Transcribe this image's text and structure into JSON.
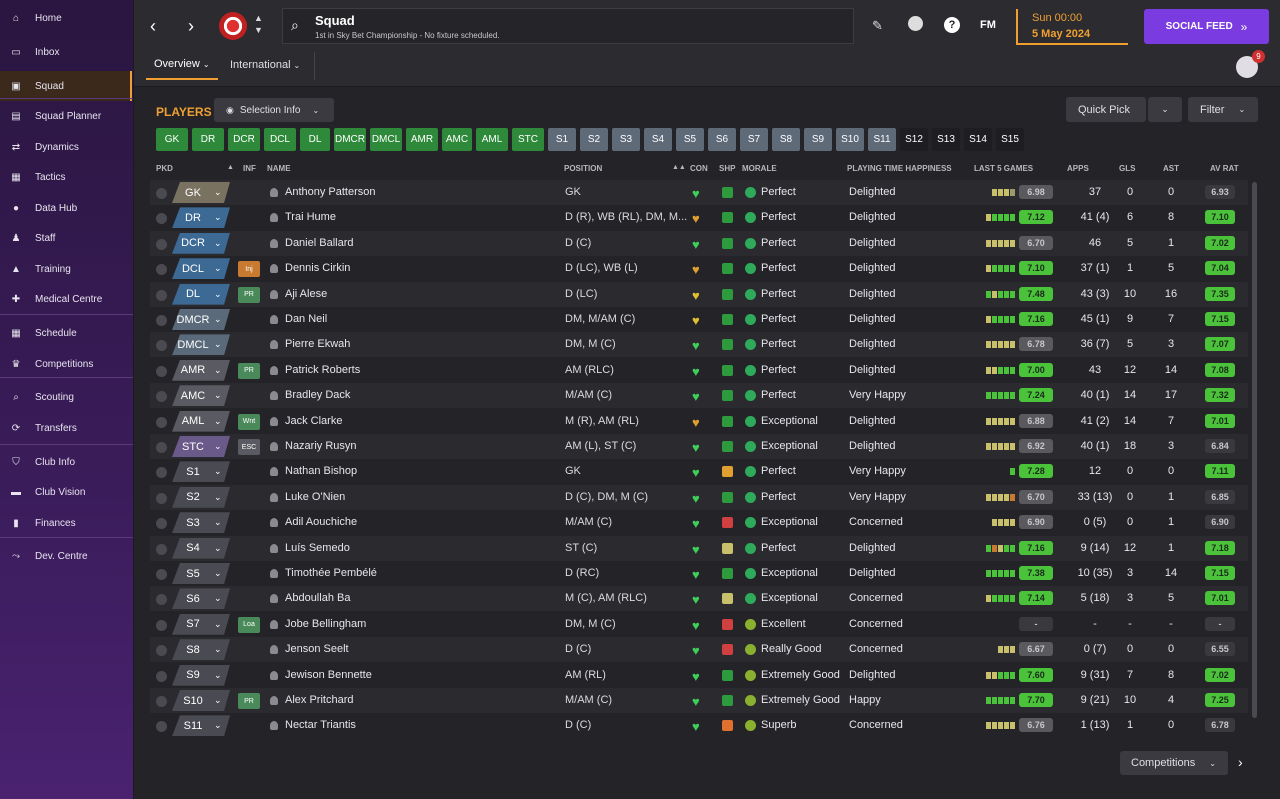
{
  "nav": [
    {
      "label": "Home",
      "icon": "home-icon"
    },
    {
      "label": "Inbox",
      "icon": "inbox-icon"
    },
    {
      "label": "Squad",
      "icon": "shirt-icon",
      "active": true
    },
    {
      "label": "Squad Planner",
      "icon": "clipboard-icon"
    },
    {
      "label": "Dynamics",
      "icon": "dynamics-icon"
    },
    {
      "label": "Tactics",
      "icon": "tactics-icon"
    },
    {
      "label": "Data Hub",
      "icon": "data-hub-icon"
    },
    {
      "label": "Staff",
      "icon": "staff-icon"
    },
    {
      "label": "Training",
      "icon": "training-icon"
    },
    {
      "label": "Medical Centre",
      "icon": "medical-icon"
    },
    {
      "label": "Schedule",
      "icon": "calendar-icon"
    },
    {
      "label": "Competitions",
      "icon": "trophy-icon"
    },
    {
      "label": "Scouting",
      "icon": "scouting-icon"
    },
    {
      "label": "Transfers",
      "icon": "transfers-icon"
    },
    {
      "label": "Club Info",
      "icon": "shield-icon"
    },
    {
      "label": "Club Vision",
      "icon": "briefcase-icon"
    },
    {
      "label": "Finances",
      "icon": "finances-icon"
    },
    {
      "label": "Dev. Centre",
      "icon": "dev-centre-icon"
    }
  ],
  "header": {
    "title": "Squad",
    "subtitle": "1st in Sky Bet Championship - No fixture scheduled.",
    "time": "Sun 00:00",
    "date": "5 May 2024",
    "social_feed": "SOCIAL FEED",
    "fm_label": "FM",
    "help_label": "?",
    "notification_count": "9",
    "tabs": [
      "Overview",
      "International"
    ]
  },
  "panel": {
    "title": "PLAYERS",
    "selection_info": "Selection Info",
    "quick_pick": "Quick Pick",
    "filter": "Filter",
    "competitions": "Competitions"
  },
  "chips": [
    "GK",
    "DR",
    "DCR",
    "DCL",
    "DL",
    "DMCR",
    "DMCL",
    "AMR",
    "AMC",
    "AML",
    "STC",
    "S1",
    "S2",
    "S3",
    "S4",
    "S5",
    "S6",
    "S7",
    "S8",
    "S9",
    "S10",
    "S11",
    "S12",
    "S13",
    "S14",
    "S15"
  ],
  "columns": {
    "pkd": "PKD",
    "inf": "INF",
    "name": "NAME",
    "position": "POSITION",
    "con": "CON",
    "shp": "SHP",
    "morale": "MORALE",
    "pth": "PLAYING TIME HAPPINESS",
    "l5": "LAST 5 GAMES",
    "apps": "APPS",
    "gls": "GLS",
    "ast": "AST",
    "avr": "AV RAT"
  },
  "colors": {
    "accent": "#f0a030",
    "green": "#3ec23e",
    "purple": "#7a3ce0"
  },
  "players": [
    {
      "pkd": "GK",
      "pc": "#7a7260",
      "inf": "",
      "name": "Anthony Patterson",
      "pos": "GK",
      "con": "#3ecf5a",
      "shp": "#2e9a3e",
      "mor": "Perfect",
      "mc": "#2eaa5a",
      "pth": "Delighted",
      "l5": "6.98",
      "l5c": "#5a5a5e",
      "bars": [
        "#c8c06a",
        "#c8c06a",
        "#c8c06a",
        "#9a9a6a"
      ],
      "apps": "37",
      "gls": "0",
      "ast": "0",
      "avr": "6.93",
      "avc": "#3a3a3e"
    },
    {
      "pkd": "DR",
      "pc": "#3c6a94",
      "inf": "",
      "name": "Trai Hume",
      "pos": "D (R), WB (RL), DM, M...",
      "con": "#e0a030",
      "shp": "#2e9a3e",
      "mor": "Perfect",
      "mc": "#2eaa5a",
      "pth": "Delighted",
      "l5": "7.12",
      "l5c": "#4ac23a",
      "bars": [
        "#c8c06a",
        "#4ac23a",
        "#4ac23a",
        "#4ac23a",
        "#4ac23a"
      ],
      "apps": "41 (4)",
      "gls": "6",
      "ast": "8",
      "avr": "7.10",
      "avc": "#4ac23a"
    },
    {
      "pkd": "DCR",
      "pc": "#3c6a94",
      "inf": "",
      "name": "Daniel Ballard",
      "pos": "D (C)",
      "con": "#3ecf5a",
      "shp": "#2e9a3e",
      "mor": "Perfect",
      "mc": "#2eaa5a",
      "pth": "Delighted",
      "l5": "6.70",
      "l5c": "#5a5a5e",
      "bars": [
        "#c8c06a",
        "#c8c06a",
        "#c8c06a",
        "#c8c06a",
        "#c8c06a"
      ],
      "apps": "46",
      "gls": "5",
      "ast": "1",
      "avr": "7.02",
      "avc": "#4ac23a"
    },
    {
      "pkd": "DCL",
      "pc": "#3c6a94",
      "inf": "Inj",
      "ic": "#c87a30",
      "name": "Dennis Cirkin",
      "pos": "D (LC), WB (L)",
      "con": "#e0a030",
      "shp": "#2e9a3e",
      "mor": "Perfect",
      "mc": "#2eaa5a",
      "pth": "Delighted",
      "l5": "7.10",
      "l5c": "#4ac23a",
      "bars": [
        "#c8c06a",
        "#4ac23a",
        "#4ac23a",
        "#4ac23a",
        "#4ac23a"
      ],
      "apps": "37 (1)",
      "gls": "1",
      "ast": "5",
      "avr": "7.04",
      "avc": "#4ac23a"
    },
    {
      "pkd": "DL",
      "pc": "#3c6a94",
      "inf": "PR",
      "ic": "#4a8a5a",
      "name": "Aji Alese",
      "pos": "D (LC)",
      "con": "#e0c030",
      "shp": "#2e9a3e",
      "mor": "Perfect",
      "mc": "#2eaa5a",
      "pth": "Delighted",
      "l5": "7.48",
      "l5c": "#4ac23a",
      "bars": [
        "#4ac23a",
        "#c8c06a",
        "#4ac23a",
        "#4ac23a",
        "#4ac23a"
      ],
      "apps": "43 (3)",
      "gls": "10",
      "ast": "16",
      "avr": "7.35",
      "avc": "#4ac23a"
    },
    {
      "pkd": "DMCR",
      "pc": "#5a6a7a",
      "inf": "",
      "name": "Dan Neil",
      "pos": "DM, M/AM (C)",
      "con": "#e0c030",
      "shp": "#2e9a3e",
      "mor": "Perfect",
      "mc": "#2eaa5a",
      "pth": "Delighted",
      "l5": "7.16",
      "l5c": "#4ac23a",
      "bars": [
        "#c8c06a",
        "#4ac23a",
        "#4ac23a",
        "#4ac23a",
        "#4ac23a"
      ],
      "apps": "45 (1)",
      "gls": "9",
      "ast": "7",
      "avr": "7.15",
      "avc": "#4ac23a"
    },
    {
      "pkd": "DMCL",
      "pc": "#5a6a7a",
      "inf": "",
      "name": "Pierre Ekwah",
      "pos": "DM, M (C)",
      "con": "#3ecf5a",
      "shp": "#2e9a3e",
      "mor": "Perfect",
      "mc": "#2eaa5a",
      "pth": "Delighted",
      "l5": "6.78",
      "l5c": "#5a5a5e",
      "bars": [
        "#c8c06a",
        "#c8c06a",
        "#c8c06a",
        "#c8c06a",
        "#c8c06a"
      ],
      "apps": "36 (7)",
      "gls": "5",
      "ast": "3",
      "avr": "7.07",
      "avc": "#4ac23a"
    },
    {
      "pkd": "AMR",
      "pc": "#5a5a62",
      "inf": "PR",
      "ic": "#4a8a5a",
      "name": "Patrick Roberts",
      "pos": "AM (RLC)",
      "con": "#3ecf5a",
      "shp": "#2e9a3e",
      "mor": "Perfect",
      "mc": "#2eaa5a",
      "pth": "Delighted",
      "l5": "7.00",
      "l5c": "#4ac23a",
      "bars": [
        "#c8c06a",
        "#c8c06a",
        "#4ac23a",
        "#4ac23a",
        "#4ac23a"
      ],
      "apps": "43",
      "gls": "12",
      "ast": "14",
      "avr": "7.08",
      "avc": "#4ac23a"
    },
    {
      "pkd": "AMC",
      "pc": "#5a5a62",
      "inf": "",
      "name": "Bradley Dack",
      "pos": "M/AM (C)",
      "con": "#3ecf5a",
      "shp": "#2e9a3e",
      "mor": "Perfect",
      "mc": "#2eaa5a",
      "pth": "Very Happy",
      "l5": "7.24",
      "l5c": "#4ac23a",
      "bars": [
        "#4ac23a",
        "#4ac23a",
        "#4ac23a",
        "#4ac23a",
        "#4ac23a"
      ],
      "apps": "40 (1)",
      "gls": "14",
      "ast": "17",
      "avr": "7.32",
      "avc": "#4ac23a"
    },
    {
      "pkd": "AML",
      "pc": "#5a5a62",
      "inf": "Wnt",
      "ic": "#4a8a5a",
      "name": "Jack Clarke",
      "pos": "M (R), AM (RL)",
      "con": "#e0a030",
      "shp": "#2e9a3e",
      "mor": "Exceptional",
      "mc": "#2eaa5a",
      "pth": "Delighted",
      "l5": "6.88",
      "l5c": "#5a5a5e",
      "bars": [
        "#c8c06a",
        "#c8c06a",
        "#c8c06a",
        "#c8c06a",
        "#c8c06a"
      ],
      "apps": "41 (2)",
      "gls": "14",
      "ast": "7",
      "avr": "7.01",
      "avc": "#4ac23a"
    },
    {
      "pkd": "STC",
      "pc": "#6a5a8a",
      "inf": "ESC",
      "ic": "#5a5a62",
      "name": "Nazariy Rusyn",
      "pos": "AM (L), ST (C)",
      "con": "#3ecf5a",
      "shp": "#2e9a3e",
      "mor": "Exceptional",
      "mc": "#2eaa5a",
      "pth": "Delighted",
      "l5": "6.92",
      "l5c": "#5a5a5e",
      "bars": [
        "#c8c06a",
        "#c8c06a",
        "#c8c06a",
        "#c8c06a",
        "#c8c06a"
      ],
      "apps": "40 (1)",
      "gls": "18",
      "ast": "3",
      "avr": "6.84",
      "avc": "#3a3a3e"
    },
    {
      "pkd": "S1",
      "pc": "#4a4a52",
      "inf": "",
      "name": "Nathan Bishop",
      "pos": "GK",
      "con": "#3ecf5a",
      "shp": "#e0a030",
      "mor": "Perfect",
      "mc": "#2eaa5a",
      "pth": "Very Happy",
      "l5": "7.28",
      "l5c": "#4ac23a",
      "bars": [
        "#4ac23a"
      ],
      "apps": "12",
      "gls": "0",
      "ast": "0",
      "avr": "7.11",
      "avc": "#4ac23a"
    },
    {
      "pkd": "S2",
      "pc": "#4a4a52",
      "inf": "",
      "name": "Luke O'Nien",
      "pos": "D (C), DM, M (C)",
      "con": "#3ecf5a",
      "shp": "#2e9a3e",
      "mor": "Perfect",
      "mc": "#2eaa5a",
      "pth": "Very Happy",
      "l5": "6.70",
      "l5c": "#5a5a5e",
      "bars": [
        "#c8c06a",
        "#c8c06a",
        "#c8c06a",
        "#c8c06a",
        "#c87a30"
      ],
      "apps": "33 (13)",
      "gls": "0",
      "ast": "1",
      "avr": "6.85",
      "avc": "#3a3a3e"
    },
    {
      "pkd": "S3",
      "pc": "#4a4a52",
      "inf": "",
      "name": "Adil Aouchiche",
      "pos": "M/AM (C)",
      "con": "#3ecf5a",
      "shp": "#d04040",
      "mor": "Exceptional",
      "mc": "#2eaa5a",
      "pth": "Concerned",
      "l5": "6.90",
      "l5c": "#5a5a5e",
      "bars": [
        "#c8c06a",
        "#c8c06a",
        "#c8c06a",
        "#c8c06a"
      ],
      "apps": "0 (5)",
      "gls": "0",
      "ast": "1",
      "avr": "6.90",
      "avc": "#3a3a3e"
    },
    {
      "pkd": "S4",
      "pc": "#4a4a52",
      "inf": "",
      "name": "Luís Semedo",
      "pos": "ST (C)",
      "con": "#3ecf5a",
      "shp": "#c8c06a",
      "mor": "Perfect",
      "mc": "#2eaa5a",
      "pth": "Delighted",
      "l5": "7.16",
      "l5c": "#4ac23a",
      "bars": [
        "#4ac23a",
        "#c87a30",
        "#c8c06a",
        "#4ac23a",
        "#4ac23a"
      ],
      "apps": "9 (14)",
      "gls": "12",
      "ast": "1",
      "avr": "7.18",
      "avc": "#4ac23a"
    },
    {
      "pkd": "S5",
      "pc": "#4a4a52",
      "inf": "",
      "name": "Timothée Pembélé",
      "pos": "D (RC)",
      "con": "#3ecf5a",
      "shp": "#2e9a3e",
      "mor": "Exceptional",
      "mc": "#2eaa5a",
      "pth": "Delighted",
      "l5": "7.38",
      "l5c": "#4ac23a",
      "bars": [
        "#4ac23a",
        "#4ac23a",
        "#4ac23a",
        "#4ac23a",
        "#4ac23a"
      ],
      "apps": "10 (35)",
      "gls": "3",
      "ast": "14",
      "avr": "7.15",
      "avc": "#4ac23a"
    },
    {
      "pkd": "S6",
      "pc": "#4a4a52",
      "inf": "",
      "name": "Abdoullah Ba",
      "pos": "M (C), AM (RLC)",
      "con": "#3ecf5a",
      "shp": "#c8c06a",
      "mor": "Exceptional",
      "mc": "#2eaa5a",
      "pth": "Concerned",
      "l5": "7.14",
      "l5c": "#4ac23a",
      "bars": [
        "#c8c06a",
        "#4ac23a",
        "#4ac23a",
        "#4ac23a",
        "#4ac23a"
      ],
      "apps": "5 (18)",
      "gls": "3",
      "ast": "5",
      "avr": "7.01",
      "avc": "#4ac23a"
    },
    {
      "pkd": "S7",
      "pc": "#4a4a52",
      "inf": "Loa",
      "ic": "#4a8a5a",
      "name": "Jobe Bellingham",
      "pos": "DM, M (C)",
      "con": "#3ecf5a",
      "shp": "#d04040",
      "mor": "Excellent",
      "mc": "#8ab030",
      "pth": "Concerned",
      "l5": "-",
      "l5c": "#3a3a3e",
      "bars": [],
      "apps": "-",
      "gls": "-",
      "ast": "-",
      "avr": "-",
      "avc": "#3a3a3e"
    },
    {
      "pkd": "S8",
      "pc": "#4a4a52",
      "inf": "",
      "name": "Jenson Seelt",
      "pos": "D (C)",
      "con": "#3ecf5a",
      "shp": "#d04040",
      "mor": "Really Good",
      "mc": "#8ab030",
      "pth": "Concerned",
      "l5": "6.67",
      "l5c": "#5a5a5e",
      "bars": [
        "#c8c06a",
        "#c8c06a",
        "#c8c06a"
      ],
      "apps": "0 (7)",
      "gls": "0",
      "ast": "0",
      "avr": "6.55",
      "avc": "#3a3a3e"
    },
    {
      "pkd": "S9",
      "pc": "#4a4a52",
      "inf": "",
      "name": "Jewison Bennette",
      "pos": "AM (RL)",
      "con": "#3ecf5a",
      "shp": "#2e9a3e",
      "mor": "Extremely Good",
      "mc": "#8ab030",
      "pth": "Delighted",
      "l5": "7.60",
      "l5c": "#4ac23a",
      "bars": [
        "#c8c06a",
        "#c8c06a",
        "#4ac23a",
        "#4ac23a",
        "#4ac23a"
      ],
      "apps": "9 (31)",
      "gls": "7",
      "ast": "8",
      "avr": "7.02",
      "avc": "#4ac23a"
    },
    {
      "pkd": "S10",
      "pc": "#4a4a52",
      "inf": "PR",
      "ic": "#4a8a5a",
      "name": "Alex Pritchard",
      "pos": "M/AM (C)",
      "con": "#3ecf5a",
      "shp": "#2e9a3e",
      "mor": "Extremely Good",
      "mc": "#8ab030",
      "pth": "Happy",
      "l5": "7.70",
      "l5c": "#4ac23a",
      "bars": [
        "#4ac23a",
        "#4ac23a",
        "#4ac23a",
        "#4ac23a",
        "#4ac23a"
      ],
      "apps": "9 (21)",
      "gls": "10",
      "ast": "4",
      "avr": "7.25",
      "avc": "#4ac23a"
    },
    {
      "pkd": "S11",
      "pc": "#4a4a52",
      "inf": "",
      "name": "Nectar Triantis",
      "pos": "D (C)",
      "con": "#3ecf5a",
      "shp": "#e07030",
      "mor": "Superb",
      "mc": "#8ab030",
      "pth": "Concerned",
      "l5": "6.76",
      "l5c": "#5a5a5e",
      "bars": [
        "#c8c06a",
        "#c8c06a",
        "#c8c06a",
        "#c8c06a",
        "#c8c06a"
      ],
      "apps": "1 (13)",
      "gls": "1",
      "ast": "0",
      "avr": "6.78",
      "avc": "#3a3a3e"
    }
  ]
}
